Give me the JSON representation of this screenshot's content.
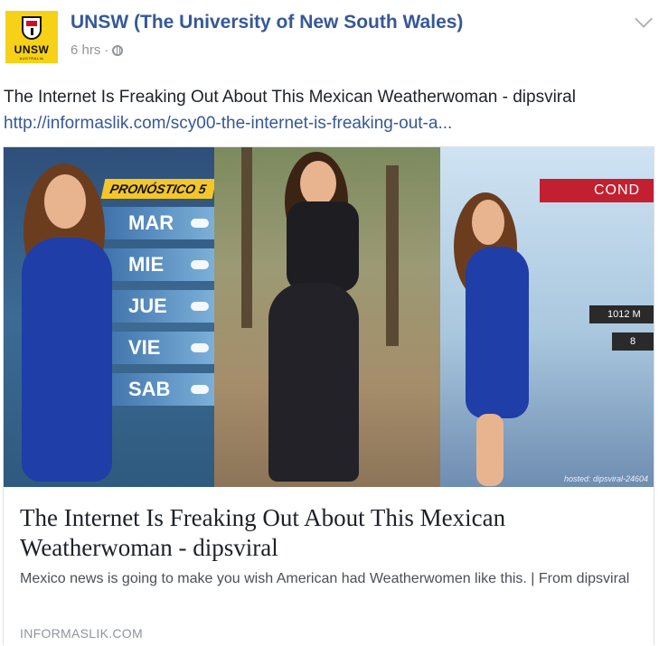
{
  "post": {
    "author": "UNSW (The University of New South Wales)",
    "timestamp": "6 hrs",
    "separator": "·",
    "text": "The Internet Is Freaking Out About This Mexican Weatherwoman - dipsviral",
    "link_text": "http://informaslik.com/scy00-the-internet-is-freaking-out-a..."
  },
  "logo": {
    "text": "UNSW",
    "subtext": "AUSTRALIA",
    "color": "#f7d117"
  },
  "image": {
    "forecast_title": "PRONÓSTICO 5",
    "days": [
      "MAR",
      "MIE",
      "JUE",
      "VIE",
      "SAB"
    ],
    "cond_label": "COND",
    "pressure_labels": [
      "1012 M",
      "8"
    ],
    "watermark": "hosted: dipsviral-24604"
  },
  "card": {
    "title": "The Internet Is Freaking Out About This Mexican Weatherwoman - dipsviral",
    "description": "Mexico news is going to make you wish American had Weatherwomen like this. | From dipsviral",
    "domain": "INFORMASLIK.COM"
  },
  "icons": {
    "privacy": "globe-icon",
    "options": "chevron-down-icon"
  },
  "colors": {
    "link": "#365899",
    "meta": "#90949c"
  }
}
